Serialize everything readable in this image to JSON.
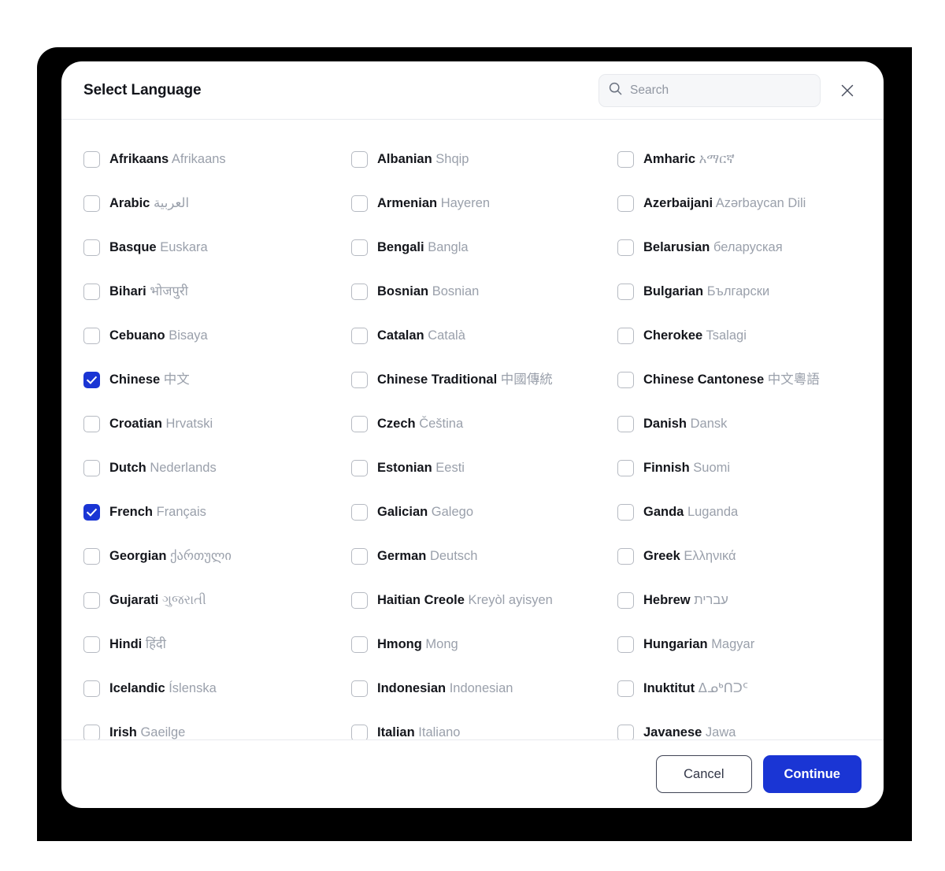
{
  "dialog": {
    "title": "Select Language",
    "close_icon": "close-icon"
  },
  "search": {
    "icon": "search-icon",
    "value": "",
    "placeholder": "Search"
  },
  "colors": {
    "accent": "#1a35d4",
    "backdrop": "#000000",
    "surface": "#ffffff",
    "name_text": "#14161c",
    "native_text": "#9aa0ab",
    "checkbox_border": "#b6bac2",
    "divider": "#e8eaee",
    "search_bg": "#f6f7f9",
    "cancel_border": "#3f4455"
  },
  "languages": [
    {
      "name": "Afrikaans",
      "native": "Afrikaans",
      "checked": false
    },
    {
      "name": "Albanian",
      "native": "Shqip",
      "checked": false
    },
    {
      "name": "Amharic",
      "native": "አማርኛ",
      "checked": false
    },
    {
      "name": "Arabic",
      "native": "العربية",
      "checked": false
    },
    {
      "name": "Armenian",
      "native": "Hayeren",
      "checked": false
    },
    {
      "name": "Azerbaijani",
      "native": "Azərbaycan Dili",
      "checked": false
    },
    {
      "name": "Basque",
      "native": "Euskara",
      "checked": false
    },
    {
      "name": "Bengali",
      "native": "Bangla",
      "checked": false
    },
    {
      "name": "Belarusian",
      "native": "беларуская",
      "checked": false
    },
    {
      "name": "Bihari",
      "native": "भोजपुरी",
      "checked": false
    },
    {
      "name": "Bosnian",
      "native": "Bosnian",
      "checked": false
    },
    {
      "name": "Bulgarian",
      "native": "Български",
      "checked": false
    },
    {
      "name": "Cebuano",
      "native": "Bisaya",
      "checked": false
    },
    {
      "name": "Catalan",
      "native": "Català",
      "checked": false
    },
    {
      "name": "Cherokee",
      "native": "Tsalagi",
      "checked": false
    },
    {
      "name": "Chinese",
      "native": "中文",
      "checked": true
    },
    {
      "name": "Chinese Traditional",
      "native": "中國傳統",
      "checked": false
    },
    {
      "name": "Chinese Cantonese",
      "native": "中文粵語",
      "checked": false
    },
    {
      "name": "Croatian",
      "native": "Hrvatski",
      "checked": false
    },
    {
      "name": "Czech",
      "native": "Čeština",
      "checked": false
    },
    {
      "name": "Danish",
      "native": "Dansk",
      "checked": false
    },
    {
      "name": "Dutch",
      "native": "Nederlands",
      "checked": false
    },
    {
      "name": "Estonian",
      "native": "Eesti",
      "checked": false
    },
    {
      "name": "Finnish",
      "native": "Suomi",
      "checked": false
    },
    {
      "name": "French",
      "native": "Français",
      "checked": true
    },
    {
      "name": "Galician",
      "native": "Galego",
      "checked": false
    },
    {
      "name": "Ganda",
      "native": "Luganda",
      "checked": false
    },
    {
      "name": "Georgian",
      "native": "ქართული",
      "checked": false
    },
    {
      "name": "German",
      "native": "Deutsch",
      "checked": false
    },
    {
      "name": "Greek",
      "native": "Ελληνικά",
      "checked": false
    },
    {
      "name": "Gujarati",
      "native": "ગુજરાતી",
      "checked": false
    },
    {
      "name": "Haitian Creole",
      "native": "Kreyòl ayisyen",
      "checked": false
    },
    {
      "name": "Hebrew",
      "native": "עברית",
      "checked": false
    },
    {
      "name": "Hindi",
      "native": "हिंदी",
      "checked": false
    },
    {
      "name": "Hmong",
      "native": "Mong",
      "checked": false
    },
    {
      "name": "Hungarian",
      "native": "Magyar",
      "checked": false
    },
    {
      "name": "Icelandic",
      "native": "Íslenska",
      "checked": false
    },
    {
      "name": "Indonesian",
      "native": "Indonesian",
      "checked": false
    },
    {
      "name": "Inuktitut",
      "native": "ᐃᓄᒃᑎᑐᑦ",
      "checked": false
    },
    {
      "name": "Irish",
      "native": "Gaeilge",
      "checked": false
    },
    {
      "name": "Italian",
      "native": "Italiano",
      "checked": false
    },
    {
      "name": "Javanese",
      "native": "Jawa",
      "checked": false
    }
  ],
  "footer": {
    "cancel_label": "Cancel",
    "continue_label": "Continue"
  }
}
